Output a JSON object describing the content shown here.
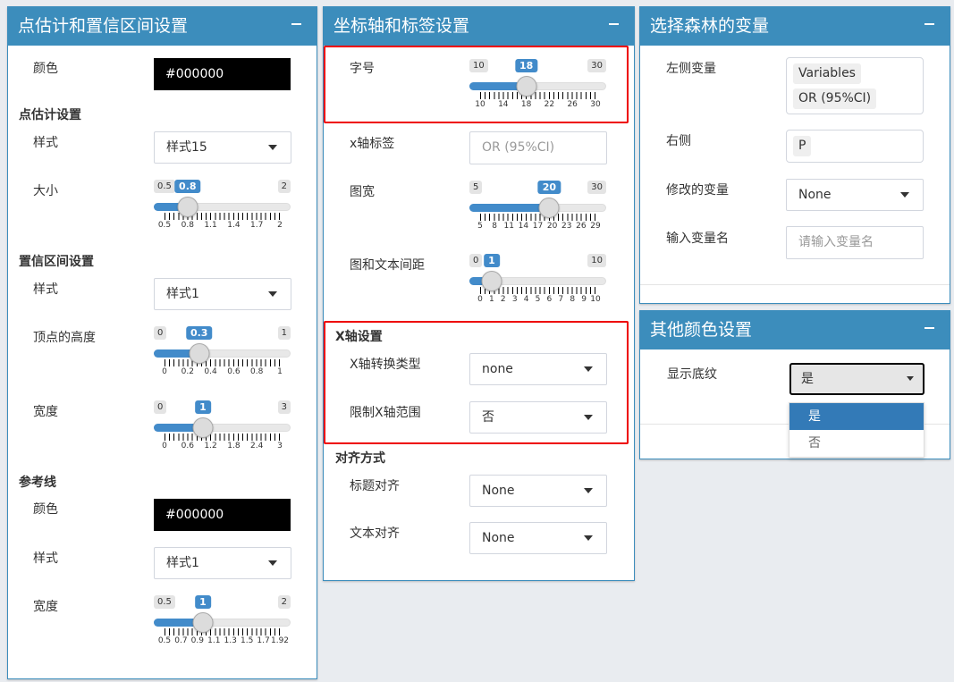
{
  "panel1": {
    "title": "点估计和置信区间设置",
    "color_label": "颜色",
    "color_value": "#000000",
    "point_section": "点估计设置",
    "point_style_label": "样式",
    "point_style_value": "样式15",
    "point_size_label": "大小",
    "point_size_slider": {
      "min": "0.5",
      "max": "2",
      "value": "0.8",
      "fraction": 0.2,
      "ticks": [
        "0.5",
        "0.8",
        "1.1",
        "1.4",
        "1.7",
        "2"
      ]
    },
    "ci_section": "置信区间设置",
    "ci_style_label": "样式",
    "ci_style_value": "样式1",
    "ci_vertex_label": "顶点的高度",
    "ci_vertex_slider": {
      "min": "0",
      "max": "1",
      "value": "0.3",
      "fraction": 0.3,
      "ticks": [
        "0",
        "0.2",
        "0.4",
        "0.6",
        "0.8",
        "1"
      ]
    },
    "ci_width_label": "宽度",
    "ci_width_slider": {
      "min": "0",
      "max": "3",
      "value": "1",
      "fraction": 0.333,
      "ticks": [
        "0",
        "0.6",
        "1.2",
        "1.8",
        "2.4",
        "3"
      ]
    },
    "ref_section": "参考线",
    "ref_color_label": "颜色",
    "ref_color_value": "#000000",
    "ref_style_label": "样式",
    "ref_style_value": "样式1",
    "ref_width_label": "宽度",
    "ref_width_slider": {
      "min": "0.5",
      "max": "2",
      "value": "1",
      "fraction": 0.333,
      "ticks": [
        "0.5",
        "0.7",
        "0.9",
        "1.1",
        "1.3",
        "1.5",
        "1.7",
        "1.92"
      ]
    }
  },
  "panel2": {
    "title": "坐标轴和标签设置",
    "font_size_label": "字号",
    "font_size_slider": {
      "min": "10",
      "max": "30",
      "value": "18",
      "fraction": 0.4,
      "ticks": [
        "10",
        "14",
        "18",
        "22",
        "26",
        "30"
      ]
    },
    "xlabel_label": "x轴标签",
    "xlabel_placeholder": "OR (95%CI)",
    "fig_width_label": "图宽",
    "fig_width_slider": {
      "min": "5",
      "max": "30",
      "value": "20",
      "fraction": 0.6,
      "ticks": [
        "5",
        "8",
        "11",
        "14",
        "17",
        "20",
        "23",
        "26",
        "29"
      ]
    },
    "gap_label": "图和文本间距",
    "gap_slider": {
      "min": "0",
      "max": "10",
      "value": "1",
      "fraction": 0.1,
      "ticks": [
        "0",
        "1",
        "2",
        "3",
        "4",
        "5",
        "6",
        "7",
        "8",
        "9",
        "10"
      ]
    },
    "xaxis_section": "X轴设置",
    "xaxis_transform_label": "X轴转换类型",
    "xaxis_transform_value": "none",
    "xaxis_limit_label": "限制X轴范围",
    "xaxis_limit_value": "否",
    "align_section": "对齐方式",
    "title_align_label": "标题对齐",
    "title_align_value": "None",
    "text_align_label": "文本对齐",
    "text_align_value": "None"
  },
  "panel3": {
    "title": "选择森林的变量",
    "left_var_label": "左侧变量",
    "left_var_tags": [
      "Variables",
      "OR (95%CI)"
    ],
    "right_label": "右侧",
    "right_tags": [
      "P"
    ],
    "modified_label": "修改的变量",
    "modified_value": "None",
    "rename_label": "输入变量名",
    "rename_placeholder": "请输入变量名"
  },
  "panel4": {
    "title": "其他颜色设置",
    "shading_label": "显示底纹",
    "shading_value": "是",
    "shading_options": [
      "是",
      "否"
    ]
  },
  "colors": {
    "accent": "#3c8dbc",
    "slider": "#428bca",
    "highlight": "#e00000"
  }
}
